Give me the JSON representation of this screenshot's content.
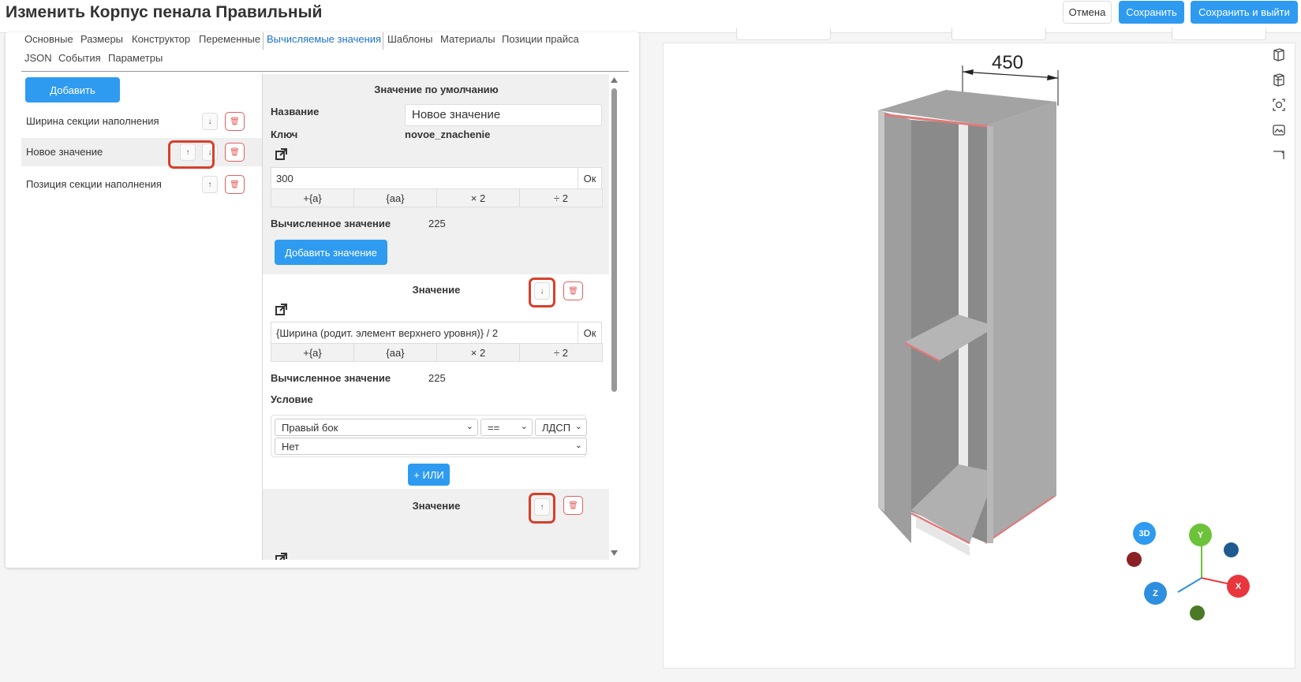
{
  "header": {
    "title": "Изменить Корпус пенала Правильный",
    "cancel_label": "Отмена",
    "save_label": "Сохранить",
    "save_exit_label": "Сохранить и выйти"
  },
  "tabs": [
    "Основные",
    "Размеры",
    "Конструктор",
    "Переменные",
    "Вычисляемые значения",
    "Шаблоны",
    "Материалы",
    "Позиции прайса",
    "JSON",
    "События",
    "Параметры"
  ],
  "active_tab": "Вычисляемые значения",
  "sidebar": {
    "add_label": "Добавить",
    "items": [
      {
        "label": "Ширина секции наполнения",
        "up": "",
        "down": "↓"
      },
      {
        "label": "Новое значение",
        "up": "↑",
        "down": "↓"
      },
      {
        "label": "Позиция секции наполнения",
        "up": "↑",
        "down": ""
      }
    ]
  },
  "default_value": {
    "title": "Значение по умолчанию",
    "name_label": "Название",
    "name_value": "Новое значение",
    "key_label": "Ключ",
    "key_value": "novoe_znachenie",
    "expression": "300",
    "ok_label": "Ок",
    "ops": [
      "+{a}",
      "{aa}",
      "× 2",
      "÷ 2"
    ],
    "computed_label": "Вычисленное значение",
    "computed_value": "225",
    "add_value_label": "Добавить значение"
  },
  "value_1": {
    "title": "Значение",
    "down": "↓",
    "expression": "{Ширина (родит. элемент верхнего уровня)} / 2",
    "ok_label": "Ок",
    "ops": [
      "+{a}",
      "{aa}",
      "× 2",
      "÷ 2"
    ],
    "computed_label": "Вычисленное значение",
    "computed_value": "225",
    "condition_label": "Условие",
    "cond_field": "Правый бок",
    "cond_op": "==",
    "cond_value": "ЛДСП",
    "cond_second": "Нет",
    "or_label": "+ ИЛИ"
  },
  "value_2": {
    "title": "Значение",
    "up": "↑"
  },
  "viewport": {
    "dimension": "450",
    "axis_3d": "3D",
    "axis_y": "Y",
    "axis_x": "X",
    "axis_z": "Z",
    "colors": {
      "accent": "#2e9bf0",
      "axis_y": "#6cc33a",
      "axis_x": "#e8363c",
      "axis_z": "#2e8ee0",
      "edge": "#e07a7a"
    }
  }
}
